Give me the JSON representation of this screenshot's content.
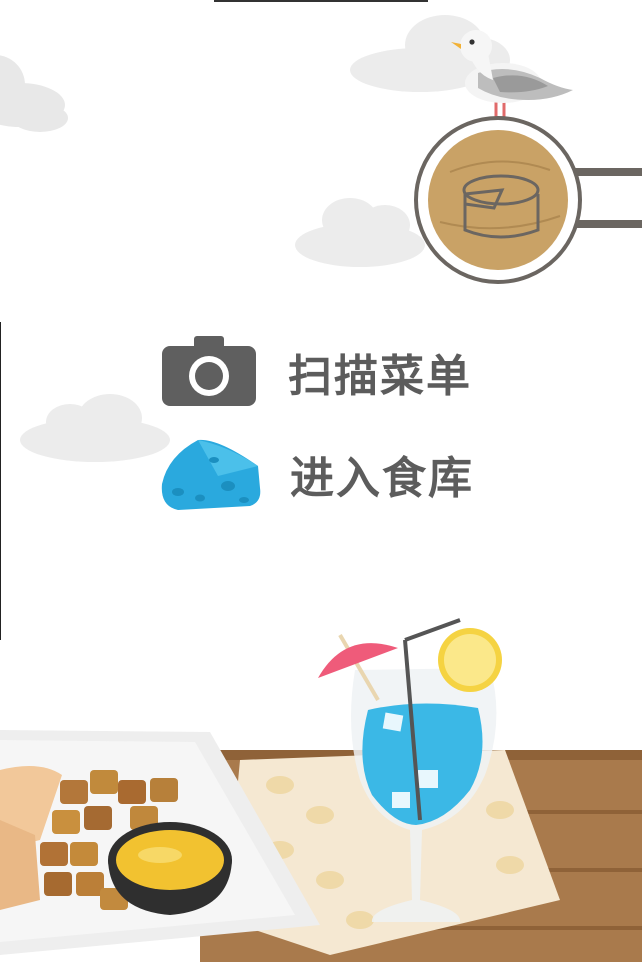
{
  "menu": {
    "scan_label": "扫描菜单",
    "library_label": "进入食库"
  },
  "icons": {
    "scan": "camera-icon",
    "library": "cheese-icon",
    "sign": "cheese-wheel-icon",
    "bird": "seagull-icon"
  },
  "colors": {
    "label_text": "#5c5c5c",
    "camera": "#5f5f5f",
    "cheese_blue": "#2aa9de",
    "sign_wood": "#c9a266",
    "table_wood": "#a97a4c",
    "drink": "#3bb8e6"
  }
}
